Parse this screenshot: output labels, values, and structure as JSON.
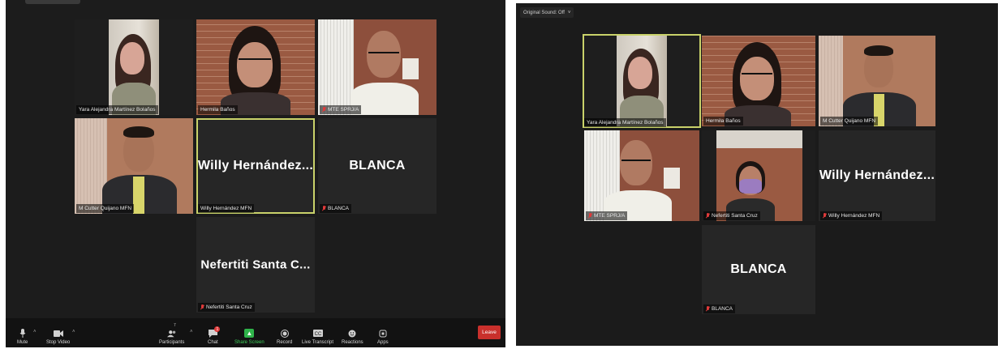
{
  "left": {
    "tiles": [
      {
        "name": "Yara Alejandra Martínez Bolaños",
        "muted": false
      },
      {
        "name": "Hermila Baños",
        "muted": false
      },
      {
        "name": "MTE SPRJ/A",
        "muted": true
      },
      {
        "name": "M Cutter Quijano MFN",
        "muted": false
      },
      {
        "name": "Willy Hernández...",
        "label": "Willy Hernández MFN",
        "muted": false,
        "active": true
      },
      {
        "name": "BLANCA",
        "label": "BLANCA",
        "muted": true
      },
      {
        "name": "Nefertiti Santa C...",
        "label": "Nefertiti Santa Cruz",
        "muted": true
      }
    ],
    "toolbar": {
      "mute": "Mute",
      "stop_video": "Stop Video",
      "participants": "Participants",
      "participants_count": "7",
      "chat": "Chat",
      "chat_badge": "1",
      "share": "Share Screen",
      "record": "Record",
      "transcript": "Live Transcript",
      "reactions": "Reactions",
      "apps": "Apps",
      "leave": "Leave"
    }
  },
  "right": {
    "original_sound": "Original Sound: Off",
    "tiles": [
      {
        "name": "Yara Alejandra Martínez Bolaños",
        "muted": false,
        "active": true
      },
      {
        "name": "Hermila Baños",
        "muted": false
      },
      {
        "name": "M Cutter Quijano MFN",
        "muted": false
      },
      {
        "name": "MTE SPRJ/A",
        "muted": true
      },
      {
        "name": "Nefertiti Santa Cruz",
        "muted": true
      },
      {
        "name": "Willy Hernández...",
        "label": "Willy Hernández MFN",
        "muted": true
      },
      {
        "name": "BLANCA",
        "label": "BLANCA",
        "muted": true
      }
    ]
  },
  "colors": {
    "active_border": "#c9d26a",
    "muted_mic": "#e03a3a",
    "leave": "#c9302c",
    "share": "#2fb34a"
  }
}
